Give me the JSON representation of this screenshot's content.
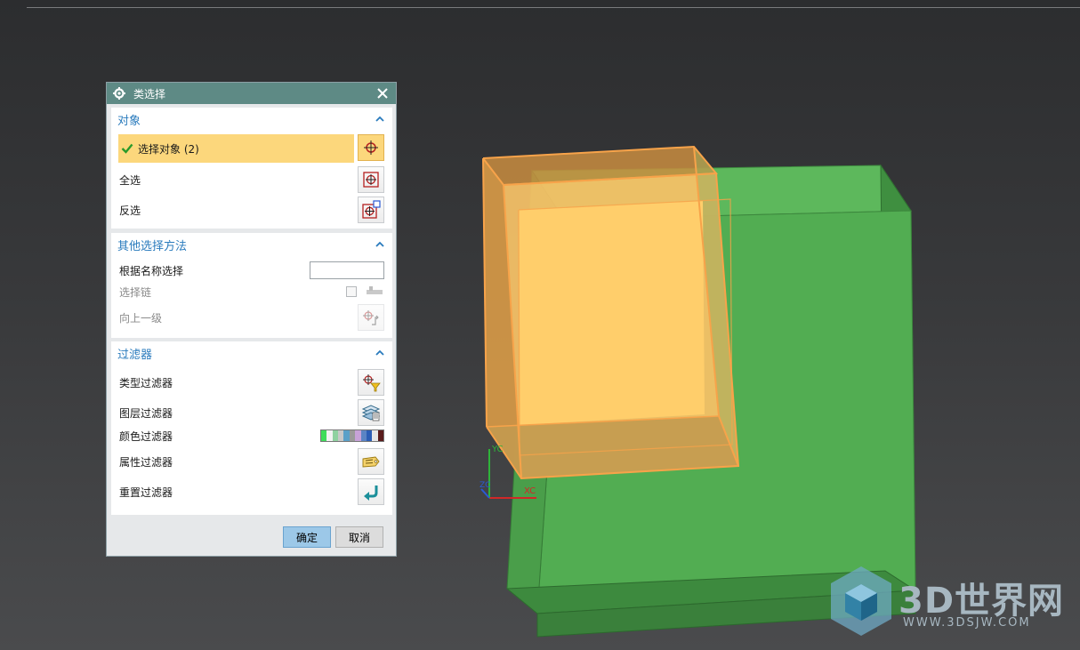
{
  "dialog": {
    "title": "类选择",
    "groups": {
      "object": {
        "header": "对象",
        "select_object_label": "选择对象 (2)",
        "select_all_label": "全选",
        "invert_label": "反选"
      },
      "other_methods": {
        "header": "其他选择方法",
        "by_name_label": "根据名称选择",
        "by_name_value": "",
        "chain_label": "选择链",
        "up_level_label": "向上一级"
      },
      "filters": {
        "header": "过滤器",
        "type_filter_label": "类型过滤器",
        "layer_filter_label": "图层过滤器",
        "color_filter_label": "颜色过滤器",
        "attribute_filter_label": "属性过滤器",
        "reset_filter_label": "重置过滤器",
        "color_swatches": [
          "#3fdc5a",
          "#f2f2f2",
          "#8fd1a0",
          "#c8c8c8",
          "#5aa0c8",
          "#9a9a9a",
          "#c7a2d8",
          "#5b84c4",
          "#2c5db5",
          "#e6e6e6",
          "#5a1c1c"
        ]
      }
    },
    "buttons": {
      "ok": "确定",
      "cancel": "取消"
    }
  },
  "viewport": {
    "axis_x": "XC",
    "axis_y": "YC",
    "axis_z": "ZC",
    "colors": {
      "green_body": "#4faa50",
      "orange_selected": "#ffcc6a",
      "highlight_edge": "#f7a34a"
    }
  },
  "watermark": {
    "logo_text": "3D世界网",
    "url_text": "WWW.3DSJW.COM"
  }
}
